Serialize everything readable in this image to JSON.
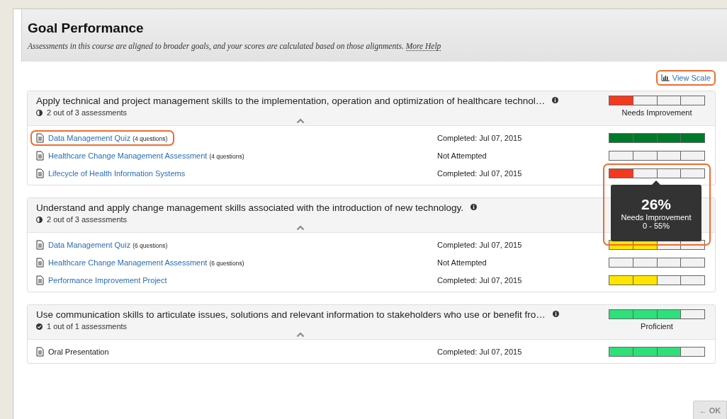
{
  "header": {
    "title": "Goal Performance",
    "description": "Assessments in this course are aligned to broader goals, and your scores are calculated based on those alignments.",
    "help_link": "More Help"
  },
  "view_scale": {
    "label": "View Scale",
    "highlighted": true
  },
  "goals": [
    {
      "title": "Apply technical and project management skills to the implementation, operation and optimization of healthcare technol…",
      "progress": "2 out of 3 assessments",
      "complete": false,
      "expanded": true,
      "bar": {
        "level": 0.25,
        "color": "#f5391f"
      },
      "rating": "Needs Improvement",
      "items": [
        {
          "name": "Data Management Quiz",
          "questions": "(4 questions)",
          "link": true,
          "highlighted": true,
          "status": "Completed: Jul 07, 2015",
          "bar": {
            "level": 1,
            "color": "#007a2a"
          }
        },
        {
          "name": "Healthcare Change Management Assessment",
          "questions": "(4 questions)",
          "link": true,
          "highlighted": false,
          "status": "Not Attempted"
        },
        {
          "name": "Lifecycle of Health Information Systems",
          "link": true,
          "highlighted": false,
          "status": "Completed: Jul 07, 2015",
          "bar": {
            "level": 0.25,
            "color": "#f5391f"
          },
          "tooltip": {
            "percent": "26%",
            "rating": "Needs Improvement",
            "range": "0 - 55%",
            "highlighted": true
          }
        }
      ]
    },
    {
      "title": "Understand and apply change management skills associated with the introduction of new technology.",
      "progress": "2 out of 3 assessments",
      "complete": false,
      "expanded": true,
      "items": [
        {
          "name": "Data Management Quiz",
          "questions": "(6 questions)",
          "link": true,
          "highlighted": false,
          "status": "Completed: Jul 07, 2015",
          "bar": {
            "level": 0.5,
            "color": "#ffe500"
          }
        },
        {
          "name": "Healthcare Change Management Assessment",
          "questions": "(6 questions)",
          "link": true,
          "highlighted": false,
          "status": "Not Attempted"
        },
        {
          "name": "Performance Improvement Project",
          "link": true,
          "highlighted": false,
          "status": "Completed: Jul 07, 2015",
          "bar": {
            "level": 0.5,
            "color": "#ffe500"
          }
        }
      ]
    },
    {
      "title": "Use communication skills to articulate issues, solutions and relevant information to stakeholders who use or benefit fro…",
      "progress": "1 out of 1 assessments",
      "complete": true,
      "expanded": true,
      "bar": {
        "level": 0.75,
        "color": "#2de07a"
      },
      "rating": "Proficient",
      "items": [
        {
          "name": "Oral Presentation",
          "link": false,
          "highlighted": false,
          "status": "Completed: Jul 07, 2015",
          "bar": {
            "level": 0.75,
            "color": "#2de07a"
          }
        }
      ]
    }
  ],
  "ok_button": "← OK"
}
